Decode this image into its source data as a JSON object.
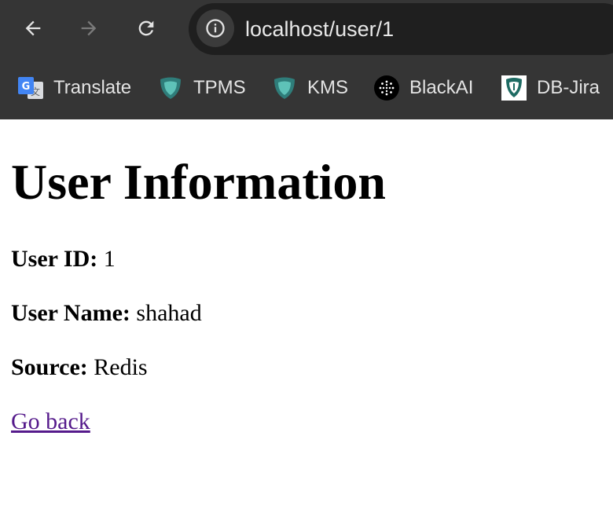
{
  "browser": {
    "url": "localhost/user/1",
    "bookmarks": [
      {
        "label": "Translate",
        "icon": "google-translate-icon"
      },
      {
        "label": "TPMS",
        "icon": "shield-icon"
      },
      {
        "label": "KMS",
        "icon": "shield-icon"
      },
      {
        "label": "BlackAI",
        "icon": "blackai-icon"
      },
      {
        "label": "DB-Jira",
        "icon": "db-jira-icon"
      }
    ]
  },
  "page": {
    "title": "User Information",
    "fields": [
      {
        "label": "User ID:",
        "value": "1"
      },
      {
        "label": "User Name:",
        "value": "shahad"
      },
      {
        "label": "Source:",
        "value": "Redis"
      }
    ],
    "back_link": "Go back"
  },
  "colors": {
    "chrome_bg": "#353535",
    "omnibox_bg": "#1f1f1f",
    "visited_link": "#551a8b"
  }
}
